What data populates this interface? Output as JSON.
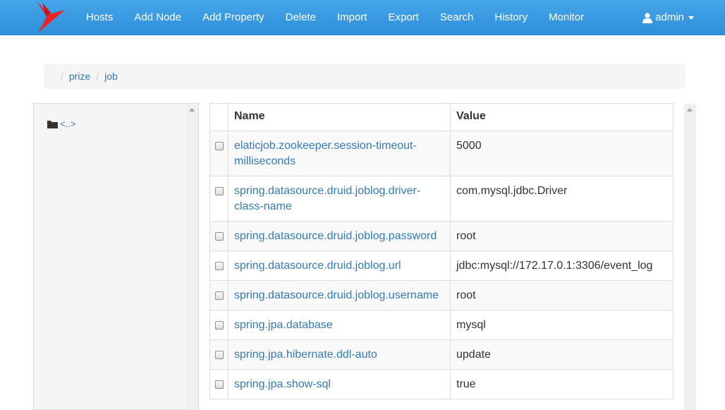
{
  "navbar": {
    "items": [
      "Hosts",
      "Add Node",
      "Add Property",
      "Delete",
      "Import",
      "Export",
      "Search",
      "History",
      "Monitor"
    ],
    "user": "admin",
    "brand_color": "#3a9be3",
    "logo_color": "#e8242b"
  },
  "breadcrumb": [
    "prize",
    "job"
  ],
  "tree": {
    "items": [
      {
        "icon": "folder-icon",
        "label": "<..>"
      }
    ]
  },
  "table": {
    "headers": {
      "name": "Name",
      "value": "Value"
    },
    "rows": [
      {
        "name": "elaticjob.zookeeper.session-timeout-milliseconds",
        "value": "5000"
      },
      {
        "name": "spring.datasource.druid.joblog.driver-class-name",
        "value": "com.mysql.jdbc.Driver"
      },
      {
        "name": "spring.datasource.druid.joblog.password",
        "value": "root"
      },
      {
        "name": "spring.datasource.druid.joblog.url",
        "value": "jdbc:mysql://172.17.0.1:3306/event_log"
      },
      {
        "name": "spring.datasource.druid.joblog.username",
        "value": "root"
      },
      {
        "name": "spring.jpa.database",
        "value": "mysql"
      },
      {
        "name": "spring.jpa.hibernate.ddl-auto",
        "value": "update"
      },
      {
        "name": "spring.jpa.show-sql",
        "value": "true"
      }
    ]
  }
}
